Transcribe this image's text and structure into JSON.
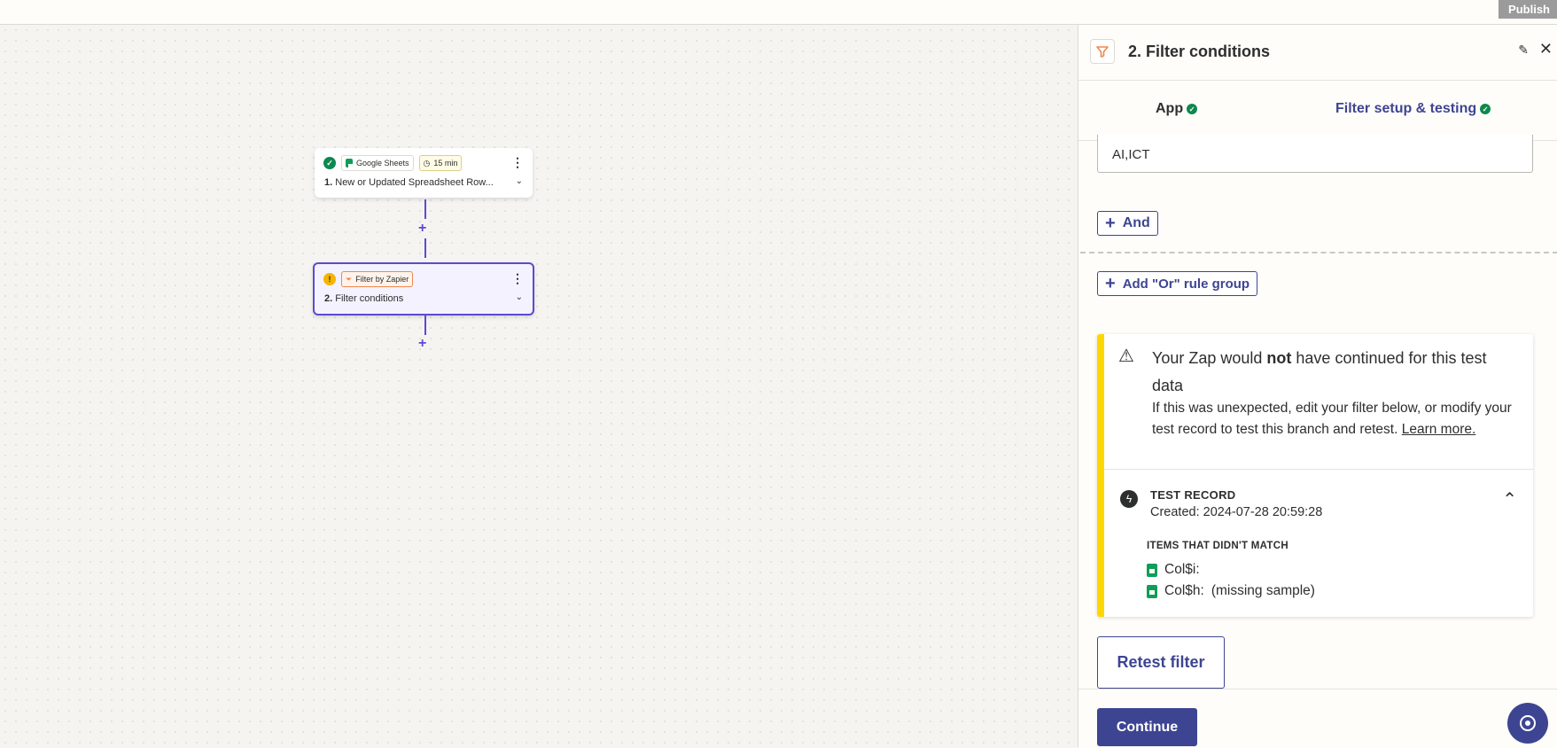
{
  "topbar": {
    "publish_label": "Publish"
  },
  "canvas": {
    "nodes": [
      {
        "app": "Google Sheets",
        "badge": "15 min",
        "step_num": "1.",
        "step_title": "New or Updated Spreadsheet Row..."
      },
      {
        "app": "Filter by Zapier",
        "step_num": "2.",
        "step_title": "Filter conditions"
      }
    ],
    "add_step_symbol": "+"
  },
  "panel": {
    "title": "2. Filter conditions",
    "tabs": [
      {
        "label": "App"
      },
      {
        "label": "Filter setup & testing"
      }
    ],
    "value_field": "AI,ICT",
    "and_label": "And",
    "or_group_label": "Add \"Or\" rule group",
    "alert": {
      "title_pre": "Your Zap would ",
      "title_bold": "not",
      "title_post": " have continued for this test data",
      "desc": "If this was unexpected, edit your filter below, or modify your test record to test this branch and retest.",
      "link": "Learn more."
    },
    "test_record": {
      "title": "TEST RECORD",
      "created": "Created: 2024-07-28 20:59:28",
      "items_label": "ITEMS THAT DIDN'T MATCH",
      "items": [
        {
          "label": "Col$i:",
          "value": ""
        },
        {
          "label": "Col$h:",
          "value": "(missing sample)"
        }
      ]
    },
    "retest_label": "Retest filter",
    "continue_label": "Continue"
  },
  "colors": {
    "accent": "#3d4592",
    "node_selected": "#5b4bcf",
    "warning": "#ffd700",
    "success": "#0f884e",
    "filter_orange": "#f0884d"
  }
}
